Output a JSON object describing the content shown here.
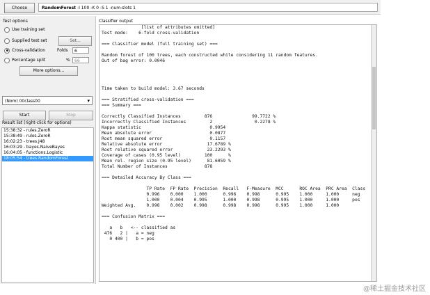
{
  "top": {
    "choose_label": "Choose",
    "classifier_name": "RandomForest",
    "classifier_args": " -I 100 -K 0 -S 1 -num-slots 1"
  },
  "test_options": {
    "title": "Test options",
    "use_training": "Use training set",
    "supplied": "Supplied test set",
    "set_label": "Set...",
    "cross": "Cross-validation",
    "folds_label": "Folds",
    "folds_value": "6",
    "percentage": "Percentage split",
    "percent_symbol": "%",
    "percent_value": "66",
    "more_options": "More options..."
  },
  "class_select": {
    "value": "(Nom) 00class00",
    "arrow": "▾"
  },
  "buttons": {
    "start": "Start",
    "stop": "Stop"
  },
  "result_list": {
    "title": "Result list (right-click for options)",
    "items": [
      "15:38:32 - rules.ZeroR",
      "15:38:49 - rules.ZeroR",
      "16:02:23 - trees.J48",
      "16:03:29 - bayes.NaiveBayes",
      "16:04:05 - functions.Logistic",
      "18:05:54 - trees.RandomForest"
    ]
  },
  "output": {
    "title": "Classifier output",
    "lines": [
      "               [list of attributes omitted]",
      "Test mode:    6-fold cross-validation",
      "",
      "=== Classifier model (full training set) ===",
      "",
      "Random forest of 100 trees, each constructed while considering 11 random features.",
      "Out of bag error: 0.0046",
      "",
      "",
      "",
      "",
      "Time taken to build model: 3.67 seconds",
      "",
      "=== Stratified cross-validation ===",
      "=== Summary ===",
      "",
      "Correctly Classified Instances         876               99.7722 %",
      "Incorrectly Classified Instances         2                0.2278 %",
      "Kappa statistic                          0.9954",
      "Mean absolute error                      0.0877",
      "Root mean squared error                  0.1157",
      "Relative absolute error                 17.6789 %",
      "Root relative squared error             23.2293 %",
      "Coverage of cases (0.95 level)         100      %",
      "Mean rel. region size (0.95 level)      81.6059 %",
      "Total Number of Instances              878",
      "",
      "=== Detailed Accuracy By Class ===",
      "",
      "                 TP Rate  FP Rate  Precision  Recall   F-Measure  MCC      ROC Area  PRC Area  Class",
      "                 0.996    0.000    1.000      0.996    0.998      0.995    1.000     1.000     neg",
      "                 1.000    0.004    0.995      1.000    0.998      0.995    1.000     1.000     pos",
      "Weighted Avg.    0.998    0.002    0.998      0.998    0.998      0.995    1.000     1.000",
      "",
      "=== Confusion Matrix ===",
      "",
      "   a   b   <-- classified as",
      " 476   2 |   a = neg",
      "   0 400 |   b = pos"
    ]
  },
  "watermark": "@稀土掘金技术社区"
}
